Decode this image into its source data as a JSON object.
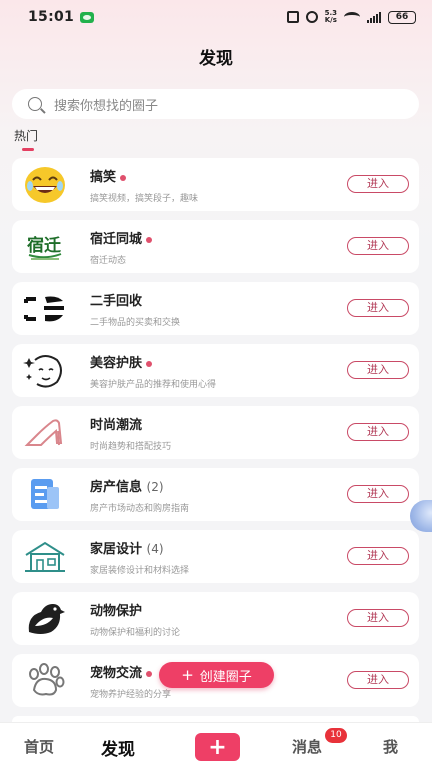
{
  "status_bar": {
    "time": "15:01",
    "speed_top": "5.3",
    "speed_bottom": "K/s",
    "battery": "66"
  },
  "header": {
    "title": "发现"
  },
  "search": {
    "placeholder": "搜索你想找的圈子"
  },
  "section": {
    "hot_label": "热门"
  },
  "circles": [
    {
      "icon": "laughing-emoji-icon",
      "title": "搞笑",
      "count": "",
      "has_dot": true,
      "desc": "搞笑视频，搞笑段子，趣味",
      "join": "进入"
    },
    {
      "icon": "suqian-logo-icon",
      "title": "宿迁同城",
      "count": "",
      "has_dot": true,
      "desc": "宿迁动态",
      "join": "进入",
      "logo_text": "宿迁"
    },
    {
      "icon": "second-hand-icon",
      "title": "二手回收",
      "count": "",
      "has_dot": false,
      "desc": "二手物品的买卖和交换",
      "join": "进入"
    },
    {
      "icon": "beauty-face-icon",
      "title": "美容护肤",
      "count": "",
      "has_dot": true,
      "desc": "美容护肤产品的推荐和使用心得",
      "join": "进入"
    },
    {
      "icon": "high-heel-icon",
      "title": "时尚潮流",
      "count": "",
      "has_dot": false,
      "desc": "时尚趋势和搭配技巧",
      "join": "进入"
    },
    {
      "icon": "document-icon",
      "title": "房产信息",
      "count": "(2)",
      "has_dot": false,
      "desc": "房产市场动态和购房指南",
      "join": "进入"
    },
    {
      "icon": "house-icon",
      "title": "家居设计",
      "count": "(4)",
      "has_dot": false,
      "desc": "家居装修设计和材料选择",
      "join": "进入"
    },
    {
      "icon": "bird-icon",
      "title": "动物保护",
      "count": "",
      "has_dot": false,
      "desc": "动物保护和福利的讨论",
      "join": "进入"
    },
    {
      "icon": "paw-icon",
      "title": "宠物交流",
      "count": "",
      "has_dot": true,
      "desc": "宠物养护经验的分享",
      "join": "进入"
    }
  ],
  "create_button": {
    "label": "创建圈子"
  },
  "tabbar": {
    "home": "首页",
    "discover": "发现",
    "plus": "+",
    "messages": "消息",
    "messages_badge": "10",
    "me": "我"
  },
  "colors": {
    "accent": "#ee3f66",
    "join_border": "#c94a66"
  }
}
